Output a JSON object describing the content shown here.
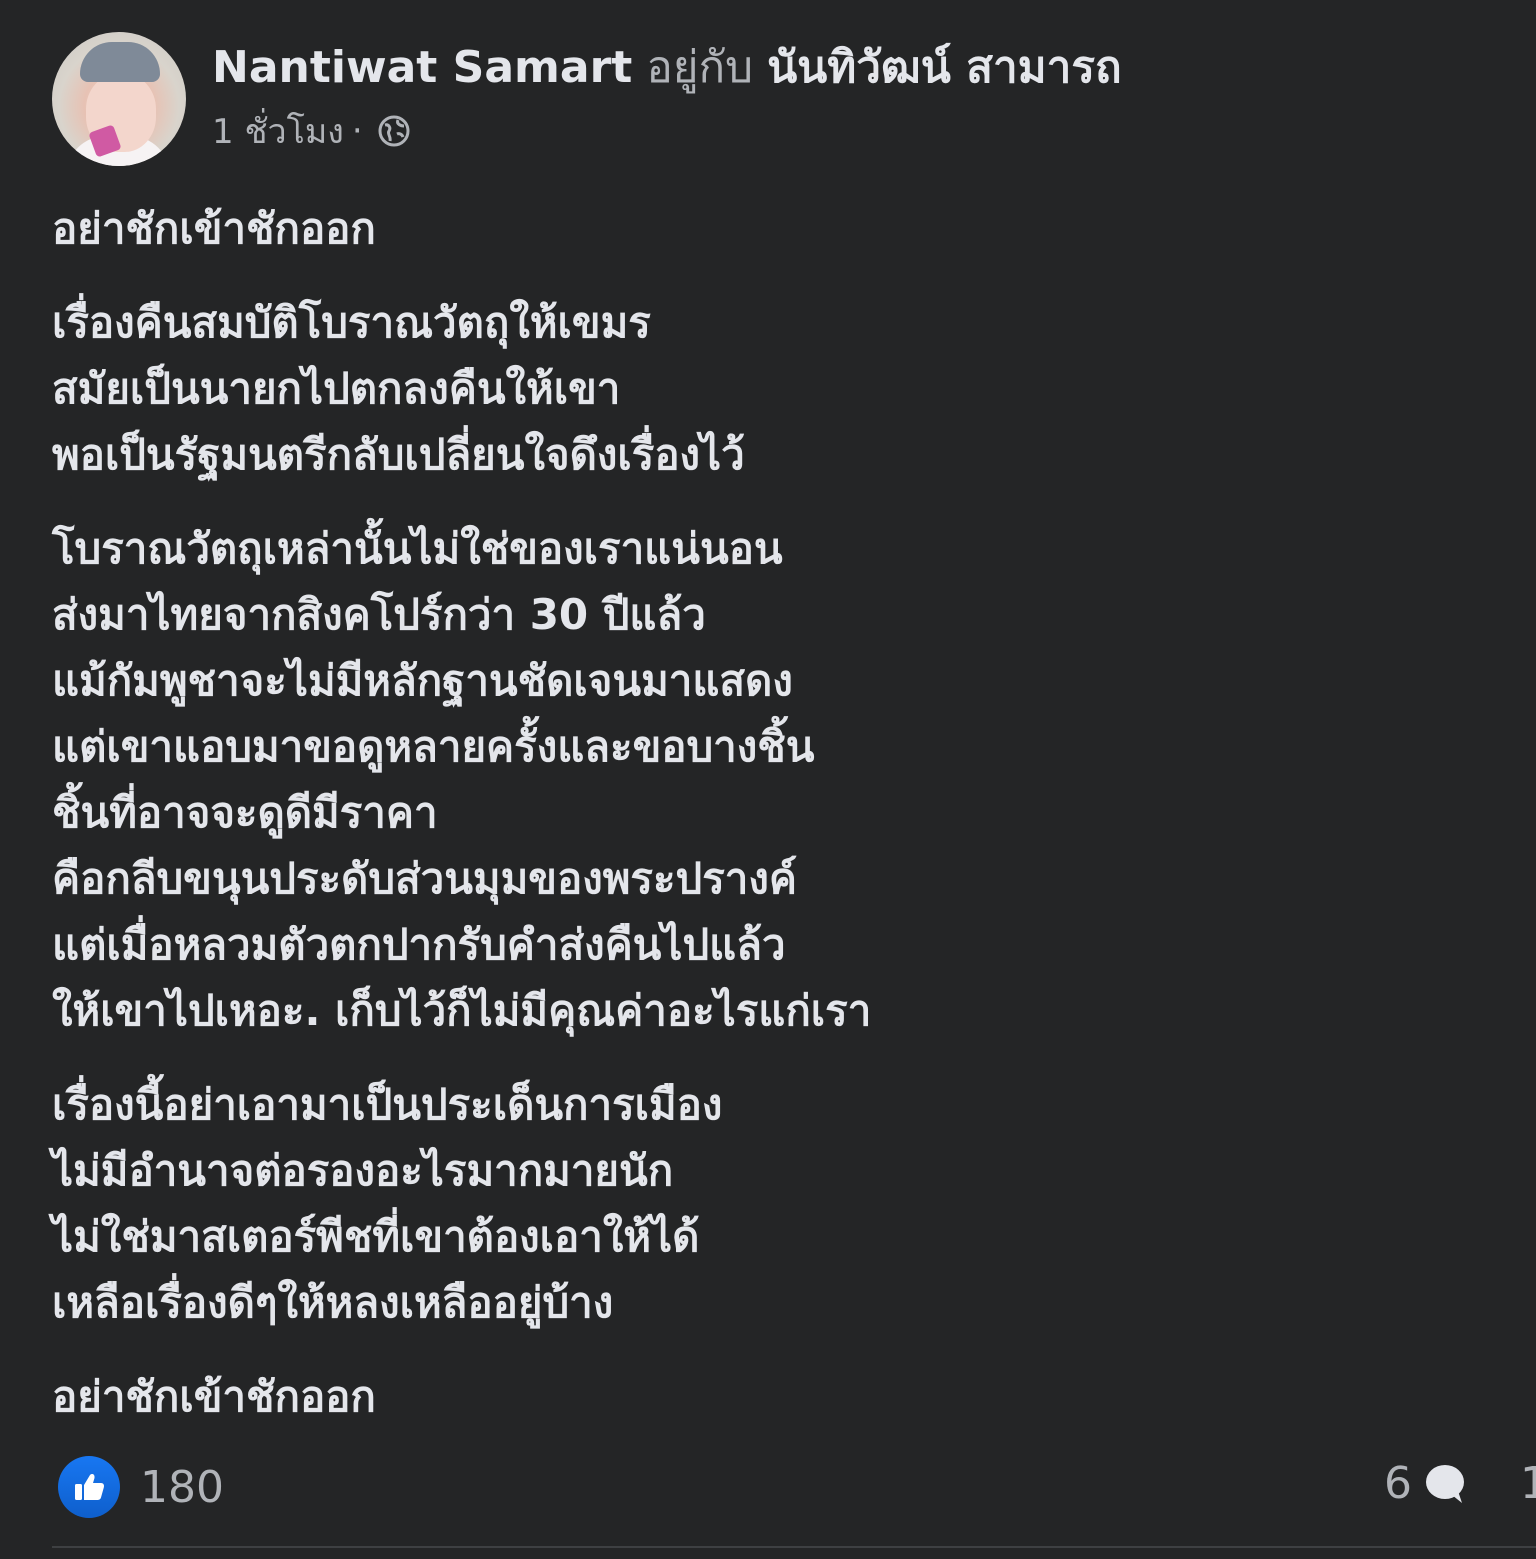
{
  "header": {
    "author": "Nantiwat Samart",
    "with_word": "อยู่กับ",
    "tagged": "นันทิวัฒน์ สามารถ",
    "time": "1 ชั่วโมง",
    "separator": "·",
    "privacy_icon": "globe-icon"
  },
  "post": {
    "paragraphs": [
      [
        "อย่าชักเข้าชักออก"
      ],
      [
        "เรื่องคืนสมบัติโบราณวัตถุให้เขมร",
        "สมัยเป็นนายกไปตกลงคืนให้เขา",
        "พอเป็นรัฐมนตรีกลับเปลี่ยนใจดึงเรื่องไว้"
      ],
      [
        "โบราณวัตถุเหล่านั้นไม่ใช่ของเราแน่นอน",
        "ส่งมาไทยจากสิงคโปร์กว่า 30 ปีแล้ว",
        "แม้กัมพูชาจะไม่มีหลักฐานชัดเจนมาแสดง",
        "แต่เขาแอบมาขอดูหลายครั้งและขอบางชิ้น",
        "ชิ้นที่อาจจะดูดีมีราคา",
        "คือกลีบขนุนประดับส่วนมุมของพระปรางค์",
        "แต่เมื่อหลวมตัวตกปากรับคำส่งคืนไปแล้ว",
        "ให้เขาไปเหอะ. เก็บไว้ก็ไม่มีคุณค่าอะไรแก่เรา"
      ],
      [
        "เรื่องนี้อย่าเอามาเป็นประเด็นการเมือง",
        "ไม่มีอำนาจต่อรองอะไรมากมายนัก",
        "ไม่ใช่มาสเตอร์พีชที่เขาต้องเอาให้ได้",
        "เหลือเรื่องดีๆให้หลงเหลืออยู่บ้าง"
      ],
      [
        "อย่าชักเข้าชักออก"
      ]
    ]
  },
  "footer": {
    "like_icon": "like-icon",
    "reactions_count": "180",
    "comments_count": "6",
    "comment_icon": "comment-icon",
    "shares_partial": "1"
  },
  "colors": {
    "background": "#242526",
    "text_primary": "#e4e6eb",
    "text_secondary": "#b0b3b8",
    "like_blue": "#1877f2"
  }
}
